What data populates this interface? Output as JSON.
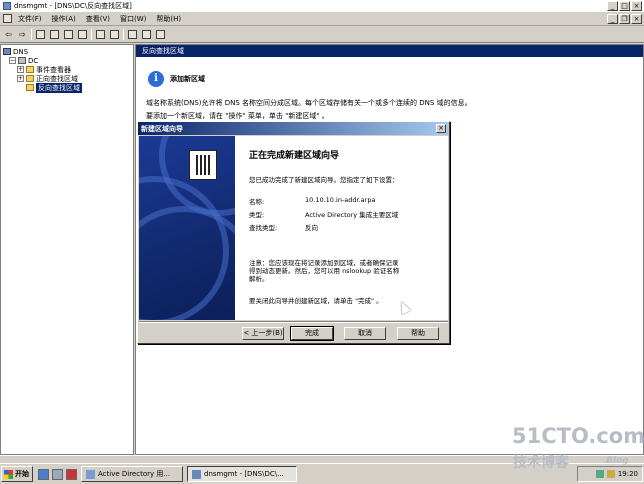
{
  "window": {
    "title": "dnsmgmt - [DNS\\DC\\反向查找区域]"
  },
  "menu": {
    "items": [
      "文件(F)",
      "操作(A)",
      "查看(V)",
      "窗口(W)",
      "帮助(H)"
    ]
  },
  "tree": {
    "root": "DNS",
    "server": "DC",
    "items": [
      "事件查看器",
      "正向查找区域",
      "反向查找区域"
    ],
    "selected": "反向查找区域"
  },
  "right_pane": {
    "header": "反向查找区域",
    "info_title": "添加新区域",
    "info_line1": "域名称系统(DNS)允许将 DNS 名称空间分成区域。每个区域存储有关一个或多个连续的 DNS 域的信息。",
    "info_line2": "要添加一个新区域，请在 \"操作\" 菜单，单击 \"新建区域\" 。"
  },
  "dialog": {
    "title": "新建区域向导",
    "heading": "正在完成新建区域向导",
    "intro": "您已成功完成了新建区域向导。您指定了如下设置：",
    "fields": [
      {
        "label": "名称:",
        "value": "10.10.10.in-addr.arpa"
      },
      {
        "label": "类型:",
        "value": "Active Directory 集成主要区域"
      },
      {
        "label": "查找类型:",
        "value": "反向"
      }
    ],
    "note_line1": "注意：您应该现在将记录添加到区域，或者确保记录",
    "note_line2": "得到动态更新。然后，您可以用 nslookup 验证名称",
    "note_line3": "解析。",
    "finish_hint": "要关闭此向导并创建新区域，请单击 \"完成\" 。",
    "buttons": {
      "back": "< 上一步(B)",
      "finish": "完成",
      "cancel": "取消",
      "help": "帮助"
    }
  },
  "taskbar": {
    "start": "开始",
    "tasks": [
      "Active Directory 用...",
      "dnsmgmt - [DNS\\DC\\..."
    ],
    "clock": "19:20"
  },
  "watermark": {
    "site": "51CTO.com",
    "blog_cn": "技术博客",
    "blog_en": "Blog"
  }
}
